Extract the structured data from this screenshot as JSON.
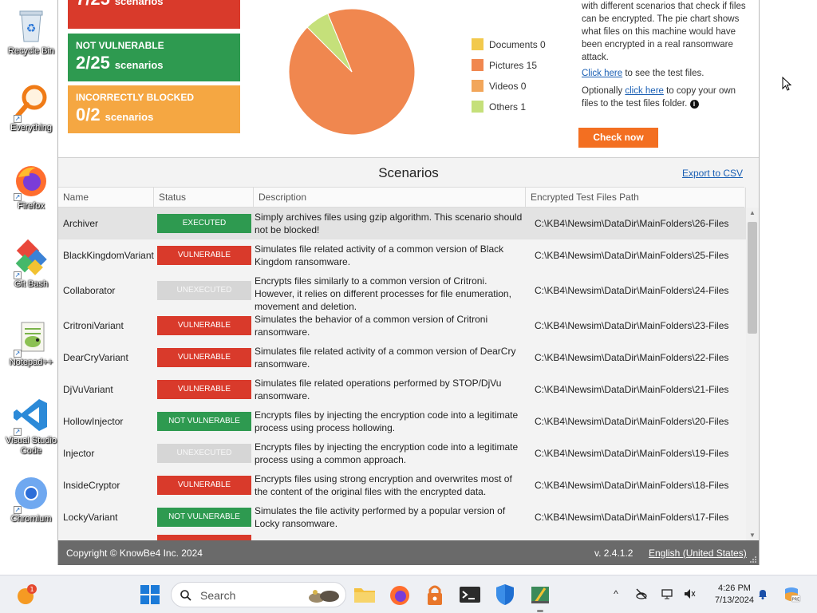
{
  "desktop_icons": [
    {
      "label": "Recycle Bin"
    },
    {
      "label": "Everything"
    },
    {
      "label": "Firefox"
    },
    {
      "label": "Git Bash"
    },
    {
      "label": "Notepad++"
    },
    {
      "label": "Visual Studio Code"
    },
    {
      "label": "Chromium"
    }
  ],
  "cards": [
    {
      "title": "",
      "count": "7/25",
      "unit": "scenarios",
      "color": "#d93a2b"
    },
    {
      "title": "NOT VULNERABLE",
      "count": "2/25",
      "unit": "scenarios",
      "color": "#2e9a50"
    },
    {
      "title": "INCORRECTLY BLOCKED",
      "count": "0/2",
      "unit": "scenarios",
      "color": "#f5a742"
    }
  ],
  "chart_data": {
    "type": "pie",
    "categories": [
      "Documents",
      "Pictures",
      "Videos",
      "Others"
    ],
    "values": [
      0,
      15,
      0,
      1
    ],
    "colors": [
      "#f2c94c",
      "#f0874f",
      "#f2a65a",
      "#c5e07a"
    ]
  },
  "legend": [
    {
      "label": "Documents 0"
    },
    {
      "label": "Pictures 15"
    },
    {
      "label": "Videos 0"
    },
    {
      "label": "Others 1"
    }
  ],
  "info": {
    "para1": "with different scenarios that check if files can be encrypted. The pie chart shows what files on this machine would have been encrypted in a real ransomware attack.",
    "link1": "Click here",
    "after_link1": " to see the test files.",
    "before_link2": "Optionally ",
    "link2": "click here",
    "after_link2": " to copy your own files to the test files folder.",
    "button": "Check now"
  },
  "scenarios": {
    "title": "Scenarios",
    "export_label": "Export to CSV",
    "columns": [
      "Name",
      "Status",
      "Description",
      "Encrypted Test Files Path"
    ],
    "rows": [
      {
        "name": "Archiver",
        "status": "EXECUTED",
        "desc": "Simply archives files using gzip algorithm. This scenario should not be blocked!",
        "path": "C:\\KB4\\Newsim\\DataDir\\MainFolders\\26-Files"
      },
      {
        "name": "BlackKingdomVariant",
        "status": "VULNERABLE",
        "desc": "Simulates file related activity of a common version of Black Kingdom ransomware.",
        "path": "C:\\KB4\\Newsim\\DataDir\\MainFolders\\25-Files"
      },
      {
        "name": "Collaborator",
        "status": "UNEXECUTED",
        "desc": "Encrypts files similarly to a common version of Critroni. However, it relies on different processes for file enumeration, movement and deletion.",
        "path": "C:\\KB4\\Newsim\\DataDir\\MainFolders\\24-Files"
      },
      {
        "name": "CritroniVariant",
        "status": "VULNERABLE",
        "desc": "Simulates the behavior of a common version of Critroni ransomware.",
        "path": "C:\\KB4\\Newsim\\DataDir\\MainFolders\\23-Files"
      },
      {
        "name": "DearCryVariant",
        "status": "VULNERABLE",
        "desc": "Simulates file related activity of a common version of DearCry ransomware.",
        "path": "C:\\KB4\\Newsim\\DataDir\\MainFolders\\22-Files"
      },
      {
        "name": "DjVuVariant",
        "status": "VULNERABLE",
        "desc": "Simulates file related operations performed by STOP/DjVu ransomware.",
        "path": "C:\\KB4\\Newsim\\DataDir\\MainFolders\\21-Files"
      },
      {
        "name": "HollowInjector",
        "status": "NOT VULNERABLE",
        "desc": "Encrypts files by injecting the encryption code into a legitimate process using process hollowing.",
        "path": "C:\\KB4\\Newsim\\DataDir\\MainFolders\\20-Files"
      },
      {
        "name": "Injector",
        "status": "UNEXECUTED",
        "desc": "Encrypts files by injecting the encryption code into a legitimate process using a common approach.",
        "path": "C:\\KB4\\Newsim\\DataDir\\MainFolders\\19-Files"
      },
      {
        "name": "InsideCryptor",
        "status": "VULNERABLE",
        "desc": "Encrypts files using strong encryption and overwrites most of the content of the original files with the encrypted data.",
        "path": "C:\\KB4\\Newsim\\DataDir\\MainFolders\\18-Files"
      },
      {
        "name": "LockyVariant",
        "status": "NOT VULNERABLE",
        "desc": "Simulates the file activity performed by a popular version of Locky ransomware.",
        "path": "C:\\KB4\\Newsim\\DataDir\\MainFolders\\17-Files"
      }
    ]
  },
  "status_colors": {
    "EXECUTED": "#2e9a50",
    "VULNERABLE": "#d93a2b",
    "UNEXECUTED": "#d6d6d6",
    "NOT VULNERABLE": "#2e9a50"
  },
  "footer": {
    "copyright": "Copyright © KnowBe4 Inc. 2024",
    "version": "v. 2.4.1.2",
    "language": "English (United States)"
  },
  "taskbar": {
    "search_placeholder": "Search",
    "time": "4:26 PM",
    "date": "7/13/2024"
  }
}
